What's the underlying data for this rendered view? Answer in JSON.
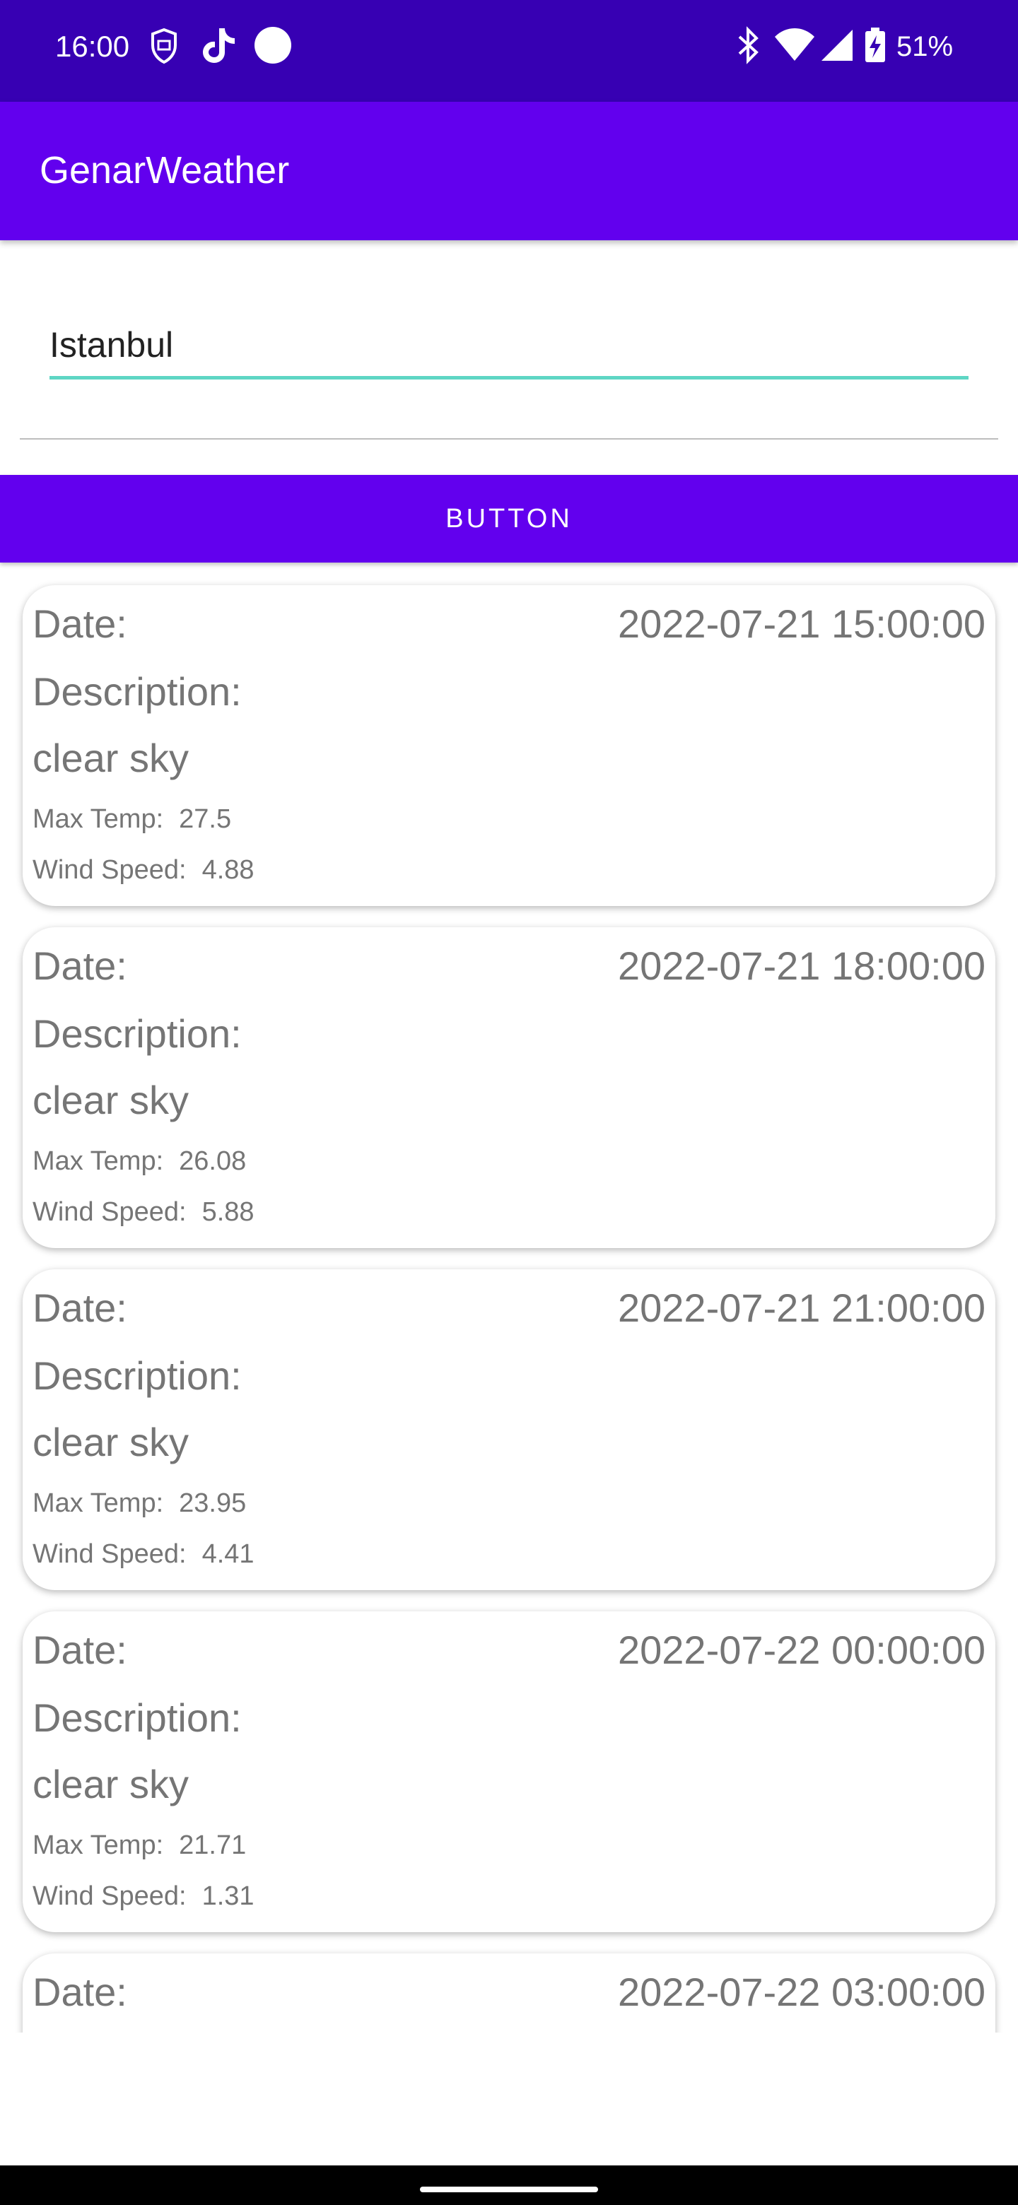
{
  "status_bar": {
    "time": "16:00",
    "left_icons": [
      "shield-icon",
      "tiktok-icon",
      "circle-icon"
    ],
    "right_icons": [
      "bluetooth-icon",
      "wifi-icon",
      "signal-icon",
      "battery-charging-icon"
    ],
    "battery": "51%"
  },
  "app_bar": {
    "title": "GenarWeather"
  },
  "search": {
    "value": "Istanbul"
  },
  "button": {
    "label": "BUTTON"
  },
  "cards": [
    {
      "date_label": "Date:",
      "date": "2022-07-21 15:00:00",
      "desc_label": "Description:",
      "description": "clear sky",
      "max_temp_label": "Max Temp:",
      "max_temp": "27.5",
      "wind_label": "Wind Speed:",
      "wind_speed": "4.88"
    },
    {
      "date_label": "Date:",
      "date": "2022-07-21 18:00:00",
      "desc_label": "Description:",
      "description": "clear sky",
      "max_temp_label": "Max Temp:",
      "max_temp": "26.08",
      "wind_label": "Wind Speed:",
      "wind_speed": "5.88"
    },
    {
      "date_label": "Date:",
      "date": "2022-07-21 21:00:00",
      "desc_label": "Description:",
      "description": "clear sky",
      "max_temp_label": "Max Temp:",
      "max_temp": "23.95",
      "wind_label": "Wind Speed:",
      "wind_speed": "4.41"
    },
    {
      "date_label": "Date:",
      "date": "2022-07-22 00:00:00",
      "desc_label": "Description:",
      "description": "clear sky",
      "max_temp_label": "Max Temp:",
      "max_temp": "21.71",
      "wind_label": "Wind Speed:",
      "wind_speed": "1.31"
    },
    {
      "date_label": "Date:",
      "date": "2022-07-22 03:00:00"
    }
  ],
  "colors": {
    "status_bar": "#3700b3",
    "primary": "#6200ee",
    "accent": "#5ed6c4",
    "card_text": "#757575"
  }
}
